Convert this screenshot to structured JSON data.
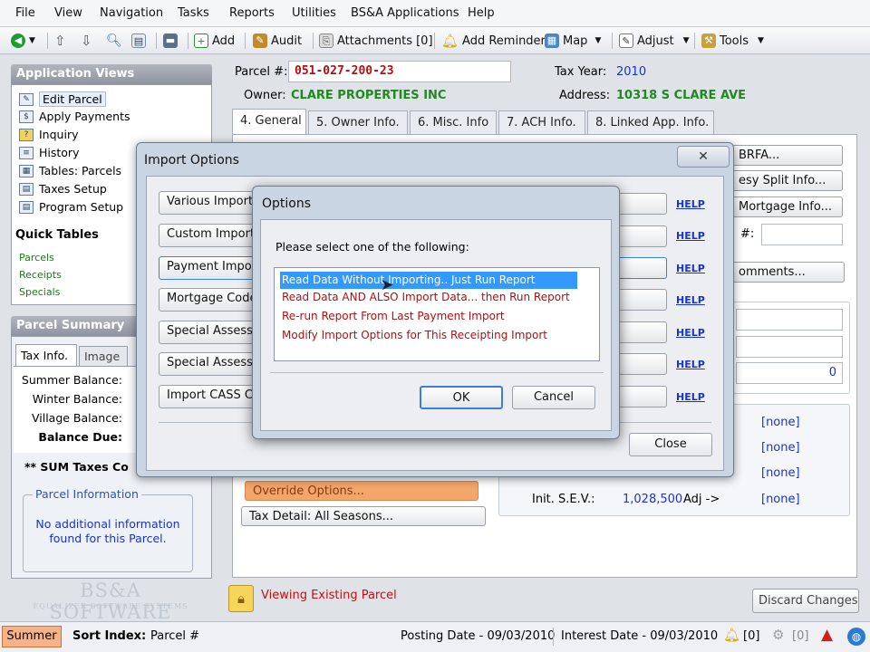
{
  "menu": [
    "File",
    "View",
    "Navigation",
    "Tasks",
    "Reports",
    "Utilities",
    "BS&A Applications",
    "Help"
  ],
  "toolbar": {
    "add": "Add",
    "audit": "Audit",
    "attachments": "Attachments [0]",
    "reminder": "Add Reminder",
    "map": "Map",
    "adjust": "Adjust",
    "tools": "Tools"
  },
  "app_views": {
    "title": "Application Views",
    "items": [
      "Edit Parcel",
      "Apply Payments",
      "Inquiry",
      "History",
      "Tables: Parcels",
      "Taxes Setup",
      "Program Setup"
    ],
    "quick_title": "Quick Tables",
    "quick": [
      "Parcels",
      "Receipts",
      "Specials"
    ]
  },
  "parcel_summary": {
    "title": "Parcel Summary",
    "tabs": [
      "Tax Info.",
      "Image"
    ],
    "rows": [
      "Summer Balance:",
      "Winter Balance:",
      "Village Balance:",
      "Balance Due:"
    ],
    "sum_taxes": "** SUM Taxes Co",
    "info_title": "Parcel Information",
    "info_text": "No additional information found for this Parcel.",
    "logo": "BS&A SOFTWARE",
    "logo_sub": "EQUALIZER SOFTWARE SYSTEMS"
  },
  "parcel": {
    "parcel_label": "Parcel #:",
    "parcel_value": "051-027-200-23",
    "taxyear_label": "Tax Year:",
    "taxyear_value": "2010",
    "owner_label": "Owner:",
    "owner_value": "CLARE PROPERTIES INC",
    "address_label": "Address:",
    "address_value": "10318 S CLARE AVE"
  },
  "tabs": [
    "4. General",
    "5. Owner Info.",
    "6. Misc. Info",
    "7. ACH Info.",
    "8. Linked App. Info."
  ],
  "right_buttons": [
    "BRFA...",
    "esy Split Info...",
    "Mortgage Info...",
    "omments..."
  ],
  "right_label": "#:",
  "zero_value": "0",
  "none_values": [
    "[none]",
    "[none]",
    "[none]",
    "[none]"
  ],
  "override": "Override Options...",
  "tax_detail": "Tax Detail: All Seasons...",
  "sev_label": "Init. S.E.V.:",
  "sev_value": "1,028,500",
  "adj_label": "Adj ->",
  "viewing": "Viewing Existing Parcel",
  "discard": "Discard Changes",
  "import_dialog": {
    "title": "Import Options",
    "buttons": [
      "Various Imports",
      "Custom Imports",
      "Payment Import",
      "Mortgage Code",
      "Special Assessm",
      "Special Assessm",
      "Import CASS CE"
    ],
    "help": "HELP",
    "close": "Close"
  },
  "options_dialog": {
    "title": "Options",
    "prompt": "Please select one of the following:",
    "items": [
      "Read Data Without Importing.. Just Run Report",
      "Read Data AND ALSO Import Data... then Run Report",
      "Re-run Report From Last Payment Import",
      "Modify Import Options for This Receipting Import"
    ],
    "ok": "OK",
    "cancel": "Cancel"
  },
  "status": {
    "season": "Summer",
    "sort_label": "Sort Index:",
    "sort_value": "Parcel #",
    "posting": "Posting Date - 09/03/2010",
    "interest": "Interest Date - 09/03/2010",
    "bell_count": "[0]",
    "gear_count": "[0]"
  },
  "colors": {
    "red_text": "#b01010",
    "green_text": "#1f8a1f",
    "selection": "#3399ff",
    "override_bg": "#f3a56a"
  }
}
